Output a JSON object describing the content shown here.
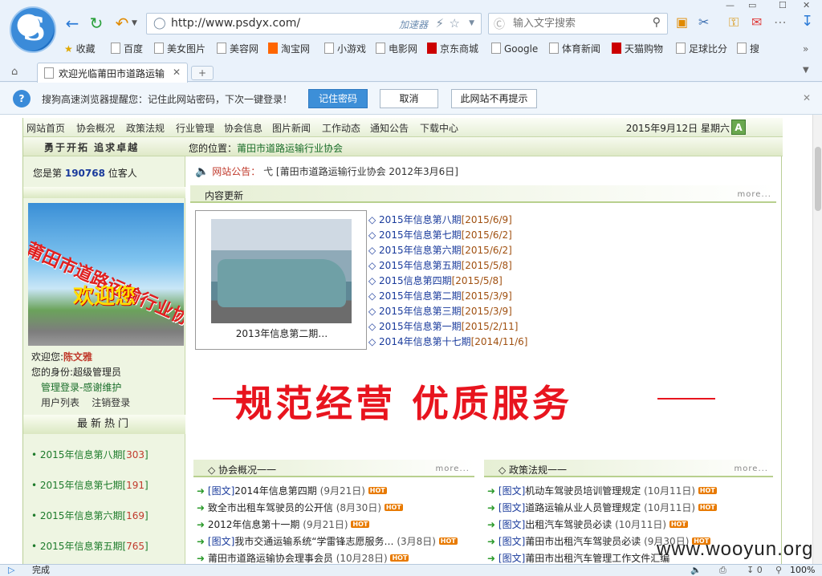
{
  "browser": {
    "url": "http://www.psdyx.com/",
    "accelerator": "加速器",
    "search_placeholder": "输入文字搜索",
    "bookmarks": [
      "收藏",
      "百度",
      "美女图片",
      "美容网",
      "淘宝网",
      "小游戏",
      "电影网",
      "京东商城",
      "Google",
      "体育新闻",
      "天猫购物",
      "足球比分",
      "搜"
    ],
    "tab_title": "欢迎光临莆田市道路运输",
    "notify": {
      "message": "搜狗高速浏览器提醒您：记住此网站密码，下次一键登录！",
      "remember": "记住密码",
      "cancel": "取消",
      "never": "此网站不再提示"
    },
    "status": {
      "left": "完成",
      "zoom": "100%",
      "count": "0"
    }
  },
  "site": {
    "nav": [
      "网站首页",
      "协会概况",
      "政策法规",
      "行业管理",
      "协会信息",
      "图片新闻",
      "工作动态",
      "通知公告",
      "下载中心"
    ],
    "date": "2015年9月12日 星期六",
    "a_badge": "A",
    "slogan": "勇于开拓  追求卓越",
    "position_label": "您的位置：",
    "position_value": "莆田市道路运输行业协会",
    "visitors_prefix": "您是第",
    "visitors_count": "190768",
    "visitors_suffix": "位客人",
    "banner_title": "莆田市道路运输行业协会",
    "banner_welcome": "欢迎您",
    "welcome_label": "欢迎您:",
    "welcome_name": "陈文雅",
    "role_label": "您的身份:",
    "role_value": "超级管理员",
    "admin_login": "管理登录-感谢维护",
    "user_list": "用户列表",
    "logout": "注销登录",
    "hot_title": "最新热门",
    "hot_items": [
      {
        "title": "2015年信息第八期",
        "count": "303"
      },
      {
        "title": "2015年信息第七期",
        "count": "191"
      },
      {
        "title": "2015年信息第六期",
        "count": "169"
      },
      {
        "title": "2015年信息第五期",
        "count": "765"
      }
    ],
    "notice_label": "网站公告：",
    "notice_text": "弋 [莆田市道路运输行业协会  2012年3月6日]",
    "content_update": "内容更新",
    "more": "more...",
    "photo_caption": "2013年信息第二期…",
    "news": [
      {
        "title": "2015年信息第八期",
        "date": "[2015/6/9]"
      },
      {
        "title": "2015年信息第七期",
        "date": "[2015/6/2]"
      },
      {
        "title": "2015年信息第六期",
        "date": "[2015/6/2]"
      },
      {
        "title": "2015年信息第五期",
        "date": "[2015/5/8]"
      },
      {
        "title": "2015信息第四期",
        "date": "[2015/5/8]"
      },
      {
        "title": "2015年信息第二期",
        "date": "[2015/3/9]"
      },
      {
        "title": "2015年信息第三期",
        "date": "[2015/3/9]"
      },
      {
        "title": "2015年信息第一期",
        "date": "[2015/2/11]"
      },
      {
        "title": "2014年信息第十七期",
        "date": "[2014/11/6]"
      }
    ],
    "big_slogan": "规范经营 优质服务",
    "assoc_title": "◇ 协会概况一一",
    "policy_title": "◇ 政策法规一一",
    "assoc_items": [
      {
        "tag": "[图文]",
        "title": "2014年信息第四期",
        "date": "(9月21日)"
      },
      {
        "tag": "",
        "title": "致全市出租车驾驶员的公开信",
        "date": "(8月30日)"
      },
      {
        "tag": "",
        "title": "2012年信息第十一期",
        "date": "(9月21日)"
      },
      {
        "tag": "[图文]",
        "title": "我市交通运输系统“学雷锋志愿服务…",
        "date": "(3月8日)"
      },
      {
        "tag": "",
        "title": "莆田市道路运输协会理事会员",
        "date": "(10月28日)"
      }
    ],
    "policy_items": [
      {
        "tag": "[图文]",
        "title": "机动车驾驶员培训管理规定",
        "date": "(10月11日)"
      },
      {
        "tag": "[图文]",
        "title": "道路运输从业人员管理规定",
        "date": "(10月11日)"
      },
      {
        "tag": "[图文]",
        "title": "出租汽车驾驶员必读",
        "date": "(10月11日)"
      },
      {
        "tag": "[图文]",
        "title": "莆田市出租汽车驾驶员必读",
        "date": "(9月30日)"
      },
      {
        "tag": "[图文]",
        "title": "莆田市出租汽车管理工作文件汇编",
        "date": ""
      }
    ],
    "hot_icon": "HOT"
  },
  "watermark": "www.wooyun.org"
}
